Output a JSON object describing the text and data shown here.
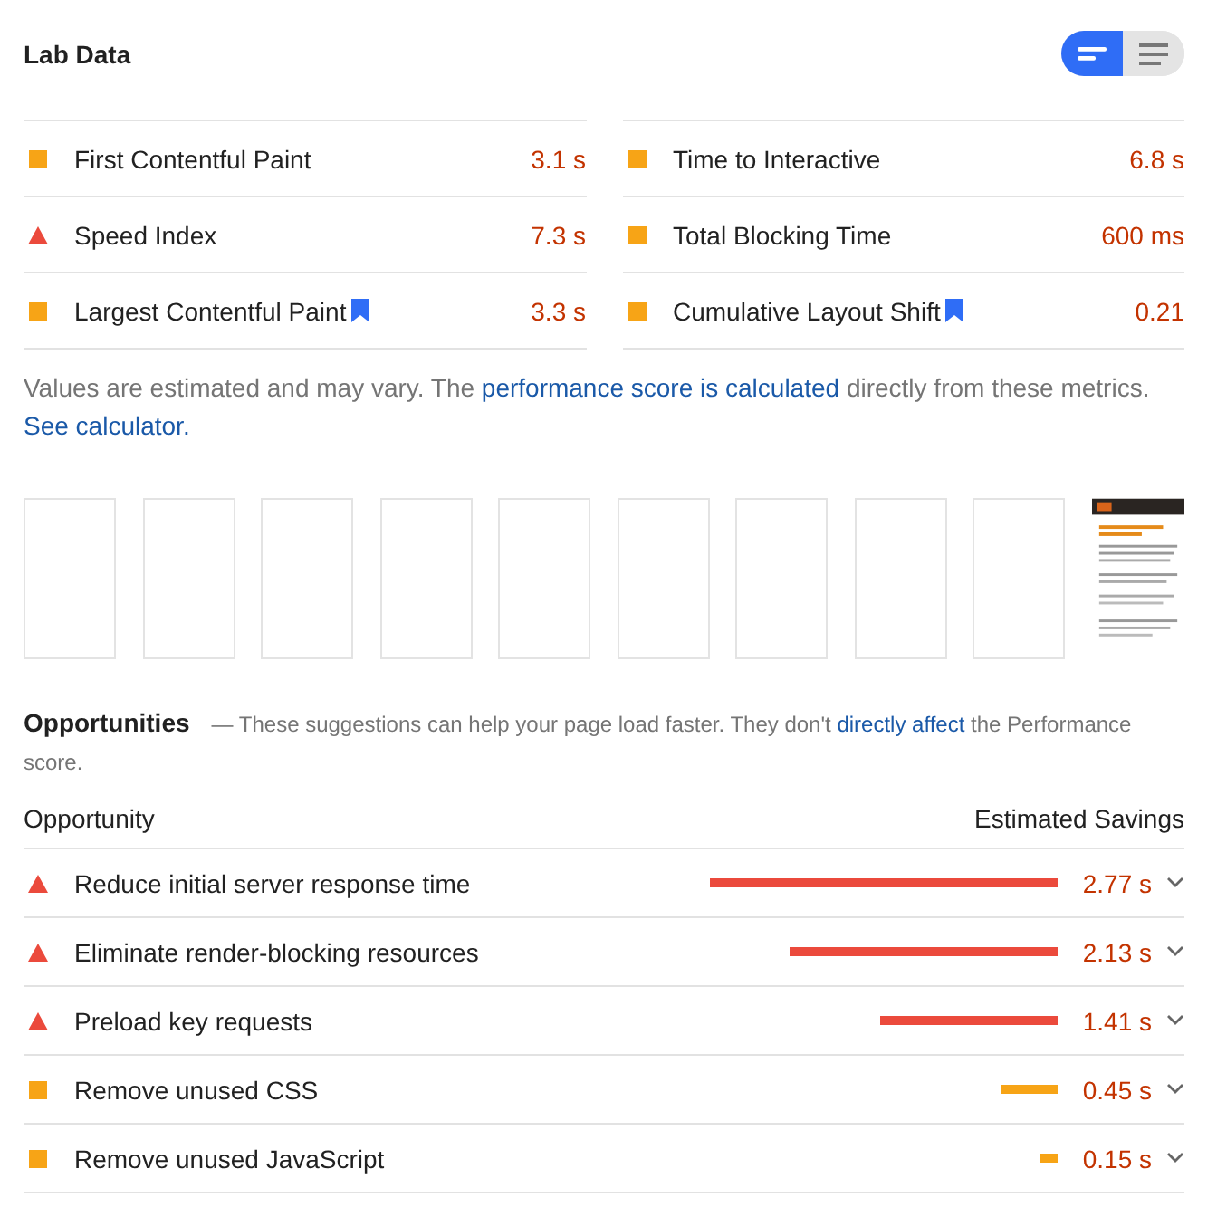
{
  "section_title": "Lab Data",
  "view_toggle": [
    {
      "kind": "bars",
      "selected": true
    },
    {
      "kind": "list",
      "selected": false
    }
  ],
  "metrics": [
    {
      "label": "First Contentful Paint",
      "value": "3.1 s",
      "kind": "average",
      "flagged": false
    },
    {
      "label": "Time to Interactive",
      "value": "6.8 s",
      "kind": "average",
      "flagged": false
    },
    {
      "label": "Speed Index",
      "value": "7.3 s",
      "kind": "fail",
      "flagged": false
    },
    {
      "label": "Total Blocking Time",
      "value": "600 ms",
      "kind": "average",
      "flagged": false
    },
    {
      "label": "Largest Contentful Paint",
      "value": "3.3 s",
      "kind": "average",
      "flagged": true
    },
    {
      "label": "Cumulative Layout Shift",
      "value": "0.21",
      "kind": "average",
      "flagged": true
    }
  ],
  "note": [
    {
      "text": "Values are estimated and may vary. The ",
      "link": false
    },
    {
      "text": "performance score is calculated",
      "link": true
    },
    {
      "text": " directly from these metrics. ",
      "link": false
    },
    {
      "text": "See calculator.",
      "link": true
    }
  ],
  "filmstrip": [
    {
      "kind": "blank"
    },
    {
      "kind": "blank"
    },
    {
      "kind": "blank"
    },
    {
      "kind": "blank"
    },
    {
      "kind": "blank"
    },
    {
      "kind": "blank"
    },
    {
      "kind": "blank"
    },
    {
      "kind": "blank"
    },
    {
      "kind": "blank"
    },
    {
      "kind": "picture"
    }
  ],
  "opportunities": {
    "title": "Opportunities",
    "description": [
      {
        "text": "— These suggestions can help your page load faster. They don't ",
        "link": false
      },
      {
        "text": "directly affect",
        "link": true
      },
      {
        "text": " the Performance score.",
        "link": false
      }
    ],
    "column_headers": [
      "Opportunity",
      "Estimated Savings"
    ],
    "rows": [
      {
        "label": "Reduce initial server response time",
        "kind": "fail",
        "savings": "2.77 s"
      },
      {
        "label": "Eliminate render-blocking resources",
        "kind": "fail",
        "savings": "2.13 s"
      },
      {
        "label": "Preload key requests",
        "kind": "fail",
        "savings": "1.41 s"
      },
      {
        "label": "Remove unused CSS",
        "kind": "average",
        "savings": "0.45 s"
      },
      {
        "label": "Remove unused JavaScript",
        "kind": "average",
        "savings": "0.15 s"
      }
    ]
  }
}
